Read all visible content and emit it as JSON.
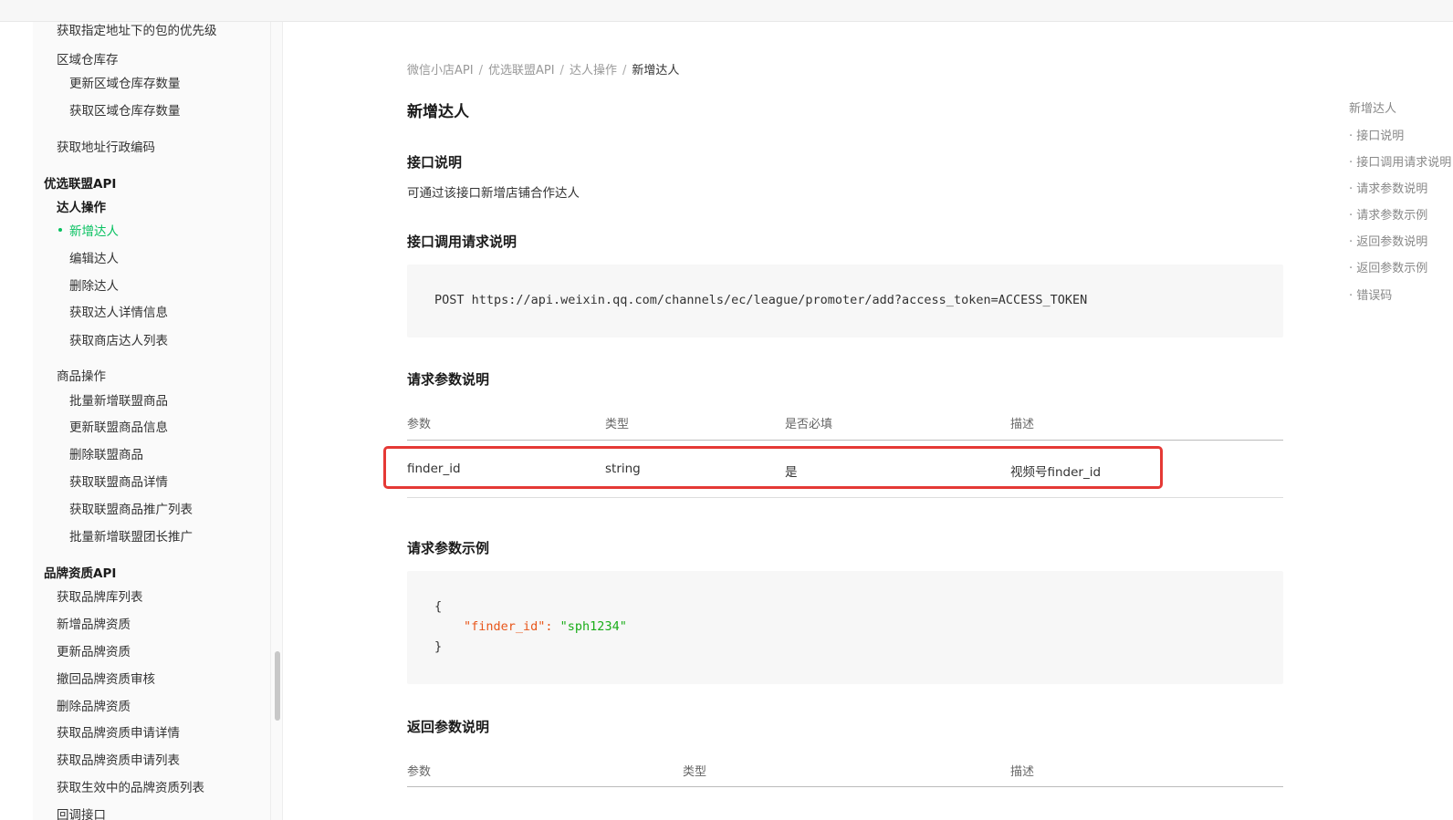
{
  "sidebar": {
    "items": [
      {
        "label": "获取指定地址下的包的优先级",
        "kind": "item",
        "level": 1
      },
      {
        "label": "区域仓库存",
        "kind": "item",
        "level": 1
      },
      {
        "label": "更新区域仓库存数量",
        "kind": "item",
        "level": 2
      },
      {
        "label": "获取区域仓库存数量",
        "kind": "item",
        "level": 2
      },
      {
        "label": "获取地址行政编码",
        "kind": "item",
        "level": 1
      },
      {
        "label": "优选联盟API",
        "kind": "group",
        "level": 0
      },
      {
        "label": "达人操作",
        "kind": "subgroup",
        "level": 1
      },
      {
        "label": "新增达人",
        "kind": "active",
        "level": 2
      },
      {
        "label": "编辑达人",
        "kind": "item",
        "level": 2
      },
      {
        "label": "删除达人",
        "kind": "item",
        "level": 2
      },
      {
        "label": "获取达人详情信息",
        "kind": "item",
        "level": 2
      },
      {
        "label": "获取商店达人列表",
        "kind": "item",
        "level": 2
      },
      {
        "label": "商品操作",
        "kind": "item",
        "level": 1
      },
      {
        "label": "批量新增联盟商品",
        "kind": "item",
        "level": 2
      },
      {
        "label": "更新联盟商品信息",
        "kind": "item",
        "level": 2
      },
      {
        "label": "删除联盟商品",
        "kind": "item",
        "level": 2
      },
      {
        "label": "获取联盟商品详情",
        "kind": "item",
        "level": 2
      },
      {
        "label": "获取联盟商品推广列表",
        "kind": "item",
        "level": 2
      },
      {
        "label": "批量新增联盟团长推广",
        "kind": "item",
        "level": 2
      },
      {
        "label": "品牌资质API",
        "kind": "group",
        "level": 0
      },
      {
        "label": "获取品牌库列表",
        "kind": "item",
        "level": 1
      },
      {
        "label": "新增品牌资质",
        "kind": "item",
        "level": 1
      },
      {
        "label": "更新品牌资质",
        "kind": "item",
        "level": 1
      },
      {
        "label": "撤回品牌资质审核",
        "kind": "item",
        "level": 1
      },
      {
        "label": "删除品牌资质",
        "kind": "item",
        "level": 1
      },
      {
        "label": "获取品牌资质申请详情",
        "kind": "item",
        "level": 1
      },
      {
        "label": "获取品牌资质申请列表",
        "kind": "item",
        "level": 1
      },
      {
        "label": "获取生效中的品牌资质列表",
        "kind": "item",
        "level": 1
      },
      {
        "label": "回调接口",
        "kind": "item",
        "level": 1
      }
    ]
  },
  "breadcrumb": {
    "items": [
      "微信小店API",
      "优选联盟API",
      "达人操作"
    ],
    "separator": "/",
    "current": "新增达人"
  },
  "page": {
    "title": "新增达人",
    "section_desc_title": "接口说明",
    "section_desc_text": "可通过该接口新增店铺合作达人",
    "section_request_title": "接口调用请求说明",
    "request_line": "POST https://api.weixin.qq.com/channels/ec/league/promoter/add?access_token=ACCESS_TOKEN",
    "section_params_title": "请求参数说明",
    "params_table": {
      "headers": [
        "参数",
        "类型",
        "是否必填",
        "描述"
      ],
      "rows": [
        [
          "finder_id",
          "string",
          "是",
          "视频号finder_id"
        ]
      ]
    },
    "section_example_title": "请求参数示例",
    "example": {
      "open": "{",
      "key": "\"finder_id\"",
      "colon": ": ",
      "value": "\"sph1234\"",
      "close": "}"
    },
    "section_return_title": "返回参数说明",
    "return_table": {
      "headers": [
        "参数",
        "类型",
        "描述"
      ]
    }
  },
  "toc": {
    "items": [
      "新增达人",
      "· 接口说明",
      "· 接口调用请求说明",
      "· 请求参数说明",
      "· 请求参数示例",
      "· 返回参数说明",
      "· 返回参数示例",
      "· 错误码"
    ]
  },
  "colors": {
    "accent": "#07c160",
    "highlight_border": "#e53935",
    "json_key": "#e8561a",
    "json_string": "#1aad19"
  }
}
